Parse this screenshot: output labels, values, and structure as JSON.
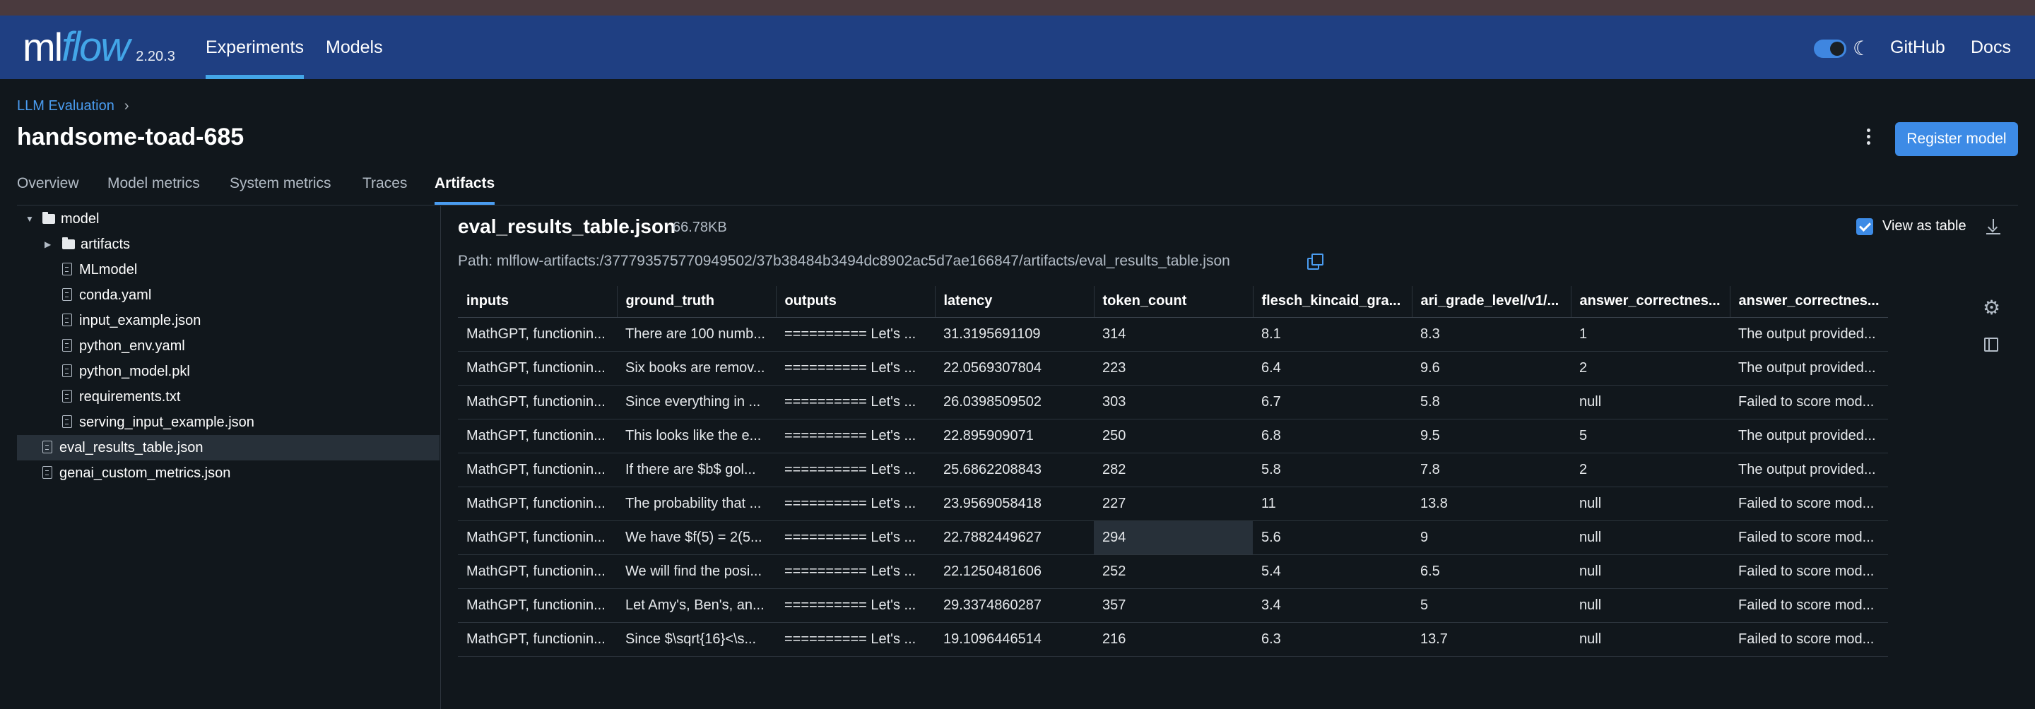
{
  "app": {
    "logo_ml": "ml",
    "logo_flow": "flow",
    "version": "2.20.3",
    "nav": [
      "Experiments",
      "Models"
    ],
    "links": [
      "GitHub",
      "Docs"
    ],
    "theme_icon": "moon-icon"
  },
  "breadcrumb": {
    "experiment": "LLM Evaluation",
    "separator": "›"
  },
  "run": {
    "title": "handsome-toad-685",
    "register_label": "Register model"
  },
  "tabs": [
    "Overview",
    "Model metrics",
    "System metrics",
    "Traces",
    "Artifacts"
  ],
  "tree": [
    {
      "label": "model",
      "type": "folder"
    },
    {
      "label": "artifacts",
      "type": "folder"
    },
    {
      "label": "MLmodel",
      "type": "file"
    },
    {
      "label": "conda.yaml",
      "type": "file"
    },
    {
      "label": "input_example.json",
      "type": "file"
    },
    {
      "label": "python_env.yaml",
      "type": "file"
    },
    {
      "label": "python_model.pkl",
      "type": "file"
    },
    {
      "label": "requirements.txt",
      "type": "file"
    },
    {
      "label": "serving_input_example.json",
      "type": "file"
    },
    {
      "label": "eval_results_table.json",
      "type": "file",
      "selected": true
    },
    {
      "label": "genai_custom_metrics.json",
      "type": "file"
    }
  ],
  "artifact": {
    "name": "eval_results_table.json",
    "size": "66.78KB",
    "view_as_table_label": "View as table",
    "view_as_table_checked": true,
    "path": "Path: mlflow-artifacts:/377793575770949502/37b38484b3494dc8902ac5d7ae166847/artifacts/eval_results_table.json"
  },
  "table": {
    "columns": [
      "inputs",
      "ground_truth",
      "outputs",
      "latency",
      "token_count",
      "flesch_kincaid_gra...",
      "ari_grade_level/v1/...",
      "answer_correctnes...",
      "answer_correctnes..."
    ],
    "rows": [
      [
        "MathGPT, functionin...",
        "There are 100 numb...",
        "========== Let's ...",
        "31.3195691109",
        "314",
        "8.1",
        "8.3",
        "1",
        "The output provided..."
      ],
      [
        "MathGPT, functionin...",
        "Six books are remov...",
        "========== Let's ...",
        "22.0569307804",
        "223",
        "6.4",
        "9.6",
        "2",
        "The output provided..."
      ],
      [
        "MathGPT, functionin...",
        "Since everything in ...",
        "========== Let's ...",
        "26.0398509502",
        "303",
        "6.7",
        "5.8",
        "null",
        "Failed to score mod..."
      ],
      [
        "MathGPT, functionin...",
        "This looks like the e...",
        "========== Let's ...",
        "22.895909071",
        "250",
        "6.8",
        "9.5",
        "5",
        "The output provided..."
      ],
      [
        "MathGPT, functionin...",
        "If there are $b$ gol...",
        "========== Let's ...",
        "25.6862208843",
        "282",
        "5.8",
        "7.8",
        "2",
        "The output provided..."
      ],
      [
        "MathGPT, functionin...",
        "The probability that ...",
        "========== Let's ...",
        "23.9569058418",
        "227",
        "11",
        "13.8",
        "null",
        "Failed to score mod..."
      ],
      [
        "MathGPT, functionin...",
        "We have $f(5) = 2(5...",
        "========== Let's ...",
        "22.7882449627",
        "294",
        "5.6",
        "9",
        "null",
        "Failed to score mod..."
      ],
      [
        "MathGPT, functionin...",
        "We will find the posi...",
        "========== Let's ...",
        "22.1250481606",
        "252",
        "5.4",
        "6.5",
        "null",
        "Failed to score mod..."
      ],
      [
        "MathGPT, functionin...",
        "Let Amy's, Ben's, an...",
        "========== Let's ...",
        "29.3374860287",
        "357",
        "3.4",
        "5",
        "null",
        "Failed to score mod..."
      ],
      [
        "MathGPT, functionin...",
        "Since $\\sqrt{16}<\\s...",
        "========== Let's ...",
        "19.1096446514",
        "216",
        "6.3",
        "13.7",
        "null",
        "Failed to score mod..."
      ]
    ],
    "highlighted_cell": {
      "row": 6,
      "col": 4
    }
  },
  "colors": {
    "navbar": "#1f3f82",
    "accent": "#43a6e8",
    "background": "#11171c",
    "primary_button": "#3d8be6"
  }
}
